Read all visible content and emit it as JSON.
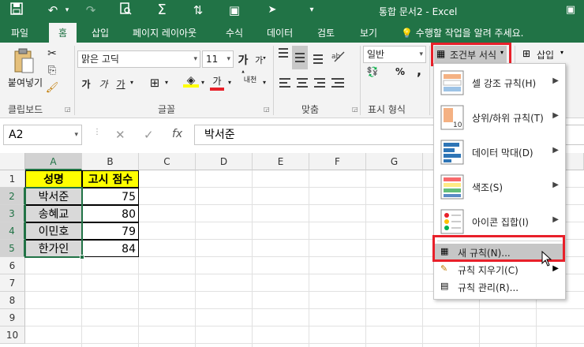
{
  "app": {
    "title": "통합 문서2 - Excel"
  },
  "quick_access": {
    "save_icon": "save-icon",
    "undo_icon": "undo-icon",
    "redo_icon": "redo-icon",
    "print_preview_icon": "print-preview-icon",
    "sum_icon": "autosum-icon"
  },
  "tabs": [
    {
      "label": "파일"
    },
    {
      "label": "홈"
    },
    {
      "label": "삽입"
    },
    {
      "label": "페이지 레이아웃"
    },
    {
      "label": "수식"
    },
    {
      "label": "데이터"
    },
    {
      "label": "검토"
    },
    {
      "label": "보기"
    }
  ],
  "tell_me": "수행할 작업을 알려 주세요.",
  "ribbon": {
    "clipboard": {
      "paste_label": "붙여넣기",
      "group_label": "클립보드"
    },
    "font": {
      "font_name": "맑은 고딕",
      "font_size": "11",
      "bold": "가",
      "italic": "가",
      "underline": "가",
      "font_color_glyph": "가",
      "phonetic": "내천",
      "grow": "가",
      "shrink": "가",
      "group_label": "글꼴"
    },
    "alignment": {
      "group_label": "맞춤"
    },
    "number": {
      "format": "일반",
      "percent": "%",
      "comma": ",",
      "group_label": "표시 형식"
    },
    "styles": {
      "conditional_format_label": "조건부 서식"
    },
    "cells": {
      "insert_label": "삽입"
    }
  },
  "formula_bar": {
    "name_box": "A2",
    "fx": "fx",
    "cancel": "✕",
    "enter": "✓",
    "content": "박서준"
  },
  "sheet": {
    "columns": [
      "A",
      "B",
      "C",
      "D",
      "E",
      "F",
      "G"
    ],
    "rows": [
      "1",
      "2",
      "3",
      "4",
      "5",
      "6",
      "7",
      "8",
      "9",
      "10"
    ],
    "header_name": "성명",
    "header_score": "고시 점수",
    "data": [
      {
        "name": "박서준",
        "score": "75"
      },
      {
        "name": "송혜교",
        "score": "80"
      },
      {
        "name": "이민호",
        "score": "79"
      },
      {
        "name": "한가인",
        "score": "84"
      }
    ],
    "colors": {
      "header_fill": "#ffff00",
      "name_fill": "#d9d9d9",
      "selection": "#217346"
    }
  },
  "dropdown": {
    "items": [
      {
        "label": "셀 강조 규칙(H)"
      },
      {
        "label": "상위/하위 규칙(T)"
      },
      {
        "label": "데이터 막대(D)"
      },
      {
        "label": "색조(S)"
      },
      {
        "label": "아이콘 집합(I)"
      }
    ],
    "new_rule": "새 규칙(N)...",
    "clear_rules": "규칙 지우기(C)",
    "manage_rules": "규칙 관리(R)..."
  },
  "colors": {
    "excel_green": "#217346",
    "highlight_red": "#e8202a"
  }
}
